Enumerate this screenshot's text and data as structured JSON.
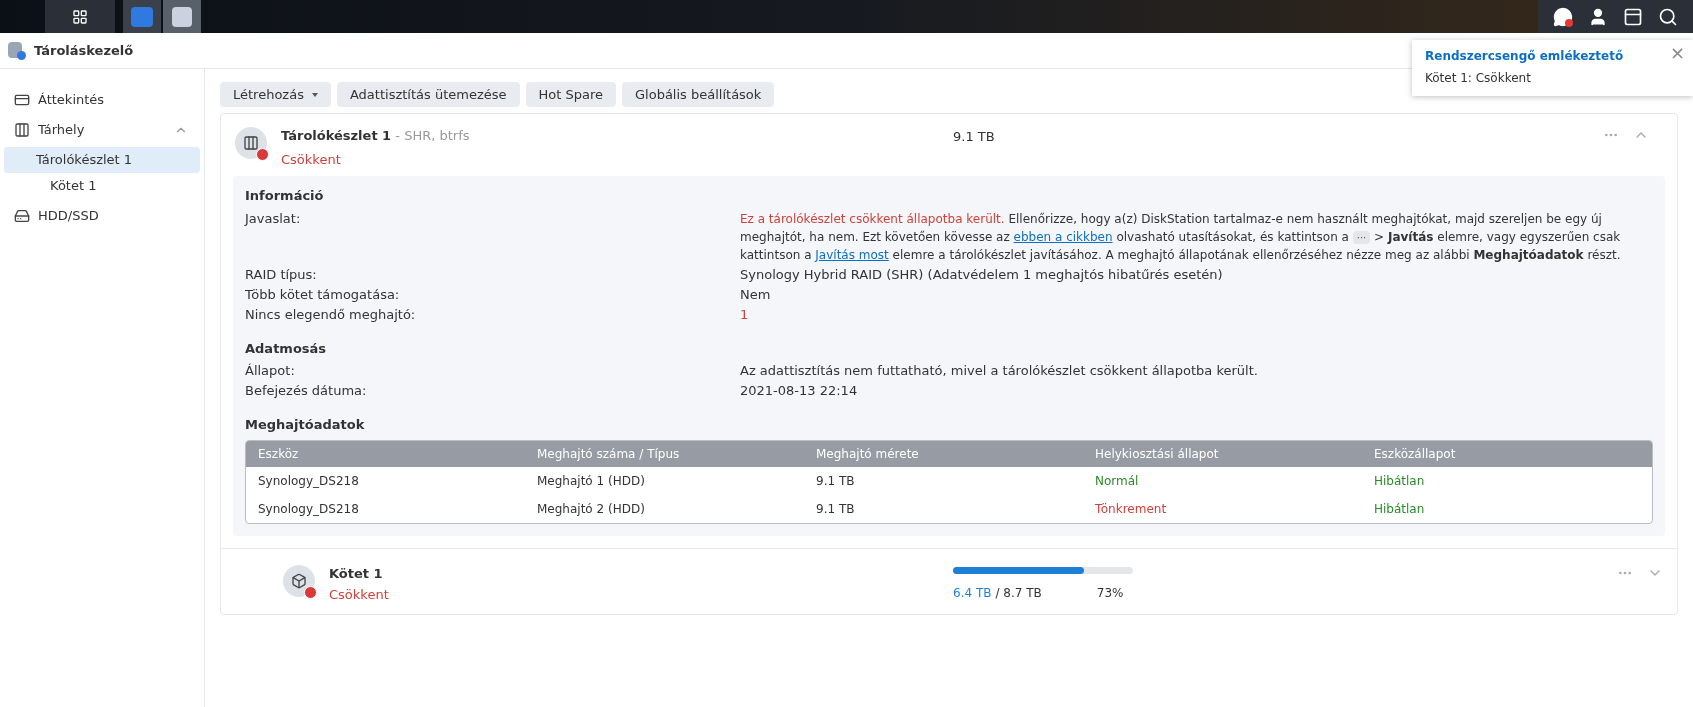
{
  "app": {
    "title": "Tároláskezelő"
  },
  "notification": {
    "title": "Rendszercsengő emlékeztető",
    "message": "Kötet 1: Csökkent",
    "close": "×"
  },
  "sidebar": {
    "items": [
      {
        "label": "Áttekintés",
        "kind": "overview",
        "selected": false
      },
      {
        "label": "Tárhely",
        "kind": "storage",
        "selected": false,
        "expanded": true,
        "children": [
          {
            "label": "Tárolókészlet 1",
            "selected": true,
            "children": [
              {
                "label": "Kötet 1",
                "selected": false
              }
            ]
          }
        ]
      },
      {
        "label": "HDD/SSD",
        "kind": "disk",
        "selected": false
      }
    ]
  },
  "toolbar": [
    {
      "label": "Létrehozás",
      "dropdown": true
    },
    {
      "label": "Adattisztítás ütemezése",
      "dropdown": false
    },
    {
      "label": "Hot Spare",
      "dropdown": false
    },
    {
      "label": "Globális beállítások",
      "dropdown": false
    }
  ],
  "pool": {
    "name": "Tárolókészlet 1",
    "subtitle": "- SHR, btrfs",
    "status": "Csökkent",
    "size": "9.1 TB",
    "expanded": true,
    "sections": [
      {
        "title": "Információ",
        "rows": [
          {
            "label": "Javaslat:",
            "kind": "rich",
            "segments": [
              {
                "kind": "warning",
                "text": "Ez a tárolókészlet csökkent állapotba került."
              },
              {
                "kind": "text",
                "text": " Ellenőrizze, hogy a(z) DiskStation tartalmaz-e nem használt meghajtókat, majd szereljen be egy új meghajtót, ha nem. Ezt követően kövesse az "
              },
              {
                "kind": "link",
                "text": "ebben a cikkben"
              },
              {
                "kind": "text",
                "text": " olvasható utasításokat, és kattintson a "
              },
              {
                "kind": "chip",
                "text": "···"
              },
              {
                "kind": "text",
                "text": " > **Javítás** elemre, vagy egyszerűen csak kattintson a "
              },
              {
                "kind": "link",
                "text": "Javítás most"
              },
              {
                "kind": "text",
                "text": " elemre a tárolókészlet javításához. A meghajtó állapotának ellenőrzéséhez nézze meg az alábbi **Meghajtóadatok** részt."
              }
            ]
          },
          {
            "label": "RAID típus:",
            "kind": "plain",
            "value": "Synology Hybrid RAID (SHR) (Adatvédelem 1 meghajtós hibatűrés esetén)"
          },
          {
            "label": "Több kötet támogatása:",
            "kind": "plain",
            "value": "Nem"
          },
          {
            "label": "Nincs elegendő meghajtó:",
            "kind": "alert",
            "value": "1"
          }
        ]
      },
      {
        "title": "Adatmosás",
        "rows": [
          {
            "label": "Állapot:",
            "kind": "plain",
            "value": "Az adattisztítás nem futtatható, mivel a tárolókészlet csökkent állapotba került."
          },
          {
            "label": "Befejezés dátuma:",
            "kind": "plain",
            "value": "2021-08-13 22:14"
          }
        ]
      }
    ],
    "drives": {
      "title": "Meghajtóadatok",
      "columns": [
        "Eszköz",
        "Meghajtó száma / Típus",
        "Meghajtó mérete",
        "Helykiosztási állapot",
        "Eszközállapot"
      ],
      "rows": [
        {
          "device": "Synology_DS218",
          "drive": "Meghajtó 1 (HDD)",
          "size": "9.1 TB",
          "allocation": {
            "text": "Normál",
            "color": "#2a8a2a"
          },
          "health": {
            "text": "Hibátlan",
            "color": "#2a8a2a"
          }
        },
        {
          "device": "Synology_DS218",
          "drive": "Meghajtó 2 (HDD)",
          "size": "9.1 TB",
          "allocation": {
            "text": "Tönkrement",
            "color": "#d0413b"
          },
          "health": {
            "text": "Hibátlan",
            "color": "#2a8a2a"
          }
        }
      ]
    }
  },
  "volume": {
    "name": "Kötet 1",
    "status": "Csökkent",
    "expanded": false,
    "level": 0.73,
    "used": "6.4 TB",
    "total": "/ 8.7 TB",
    "percent": "73%"
  }
}
